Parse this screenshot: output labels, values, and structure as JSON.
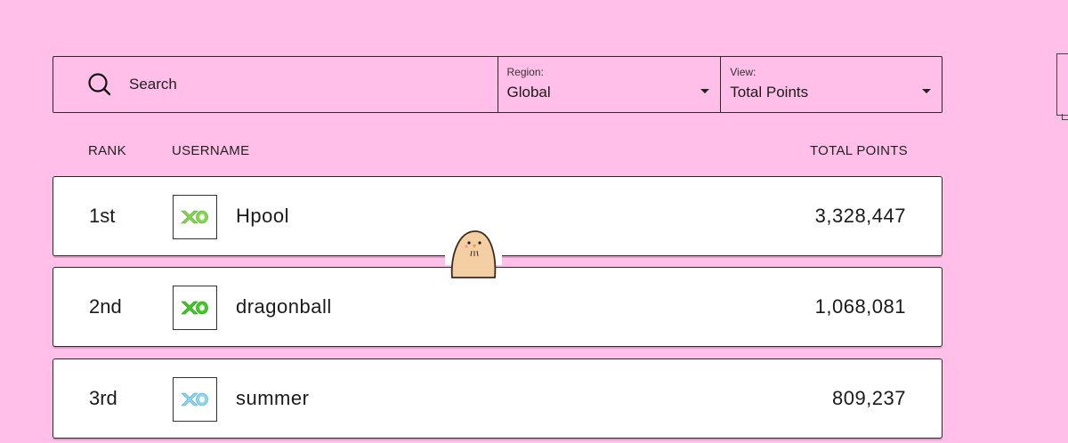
{
  "search": {
    "label": "Search",
    "icon": "search-icon"
  },
  "filters": {
    "region": {
      "label": "Region:",
      "value": "Global"
    },
    "view": {
      "label": "View:",
      "value": "Total Points"
    }
  },
  "table": {
    "headers": {
      "rank": "RANK",
      "username": "USERNAME",
      "points": "TOTAL POINTS"
    },
    "rows": [
      {
        "rank": "1st",
        "username": "Hpool",
        "points": "3,328,447",
        "avatar_color": "#7fd94a",
        "avatar_icon": "xo-logo-icon"
      },
      {
        "rank": "2nd",
        "username": "dragonball",
        "points": "1,068,081",
        "avatar_color": "#3dcc1f",
        "avatar_icon": "xo-logo-icon"
      },
      {
        "rank": "3rd",
        "username": "summer",
        "points": "809,237",
        "avatar_color": "#8fd6ec",
        "avatar_icon": "xo-logo-icon"
      }
    ]
  },
  "colors": {
    "background": "#ffbfe8",
    "row_background": "#ffffff",
    "border": "#2a2a2a"
  },
  "mascot": {
    "icon": "bird-mascot-icon"
  }
}
